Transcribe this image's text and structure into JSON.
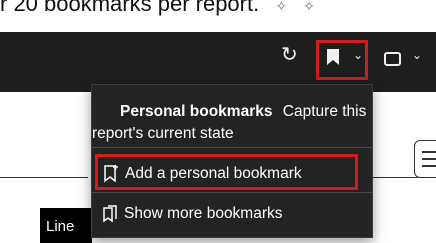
{
  "caption": {
    "text": "r 20 bookmarks per report.",
    "trailing_icons": [
      "sparkle-icon",
      "sparkle-icon"
    ]
  },
  "toolbar": {
    "icons": [
      "redo-icon",
      "bookmark-icon",
      "chevron-down-icon",
      "view-icon",
      "chevron-down-icon"
    ]
  },
  "menu": {
    "header_title": "Personal bookmarks",
    "header_desc_line1": "Capture this",
    "header_desc_line2": "report's current state",
    "items": [
      {
        "label": "Add a personal bookmark",
        "icon": "bookmark-add-icon"
      },
      {
        "label": "Show more bookmarks",
        "icon": "bookmarks-icon"
      }
    ]
  },
  "canvas": {
    "tab_label": "Line"
  },
  "colors": {
    "toolbar_bg": "#1e1e1e",
    "menu_bg": "#232323",
    "highlight": "#d21b1b"
  }
}
